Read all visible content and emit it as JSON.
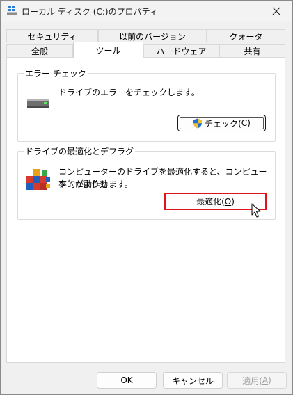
{
  "window": {
    "title": "ローカル ディスク (C:)のプロパティ"
  },
  "tabs_back": [
    {
      "label": "セキュリティ"
    },
    {
      "label": "以前のバージョン"
    },
    {
      "label": "クォータ"
    }
  ],
  "tabs_front": [
    {
      "label": "全般"
    },
    {
      "label": "ツール",
      "active": true
    },
    {
      "label": "ハードウェア"
    },
    {
      "label": "共有"
    }
  ],
  "error_check": {
    "group_label": "エラー チェック",
    "description": "ドライブのエラーをチェックします。",
    "button_label": "チェック(",
    "button_mnemonic": "C",
    "button_suffix": ")"
  },
  "optimize": {
    "group_label": "ドライブの最適化とデフラグ",
    "description_line1": "コンピューターのドライブを最適化すると、コンピューターがより効",
    "description_line2": "率的に動作します。",
    "button_label": "最適化(",
    "button_mnemonic": "O",
    "button_suffix": ")"
  },
  "footer": {
    "ok_label": "OK",
    "cancel_label": "キャンセル",
    "apply_label": "適用(",
    "apply_mnemonic": "A",
    "apply_suffix": ")"
  },
  "icons": {
    "window": "drive-windows-icon",
    "close": "close-icon",
    "drive": "hard-drive-icon",
    "shield": "uac-shield-icon",
    "optimize": "defrag-blocks-icon",
    "cursor": "mouse-pointer-icon"
  },
  "colors": {
    "highlight_red": "#e0131a",
    "shield_blue": "#1f6fd6",
    "shield_yellow": "#f2c12e"
  }
}
